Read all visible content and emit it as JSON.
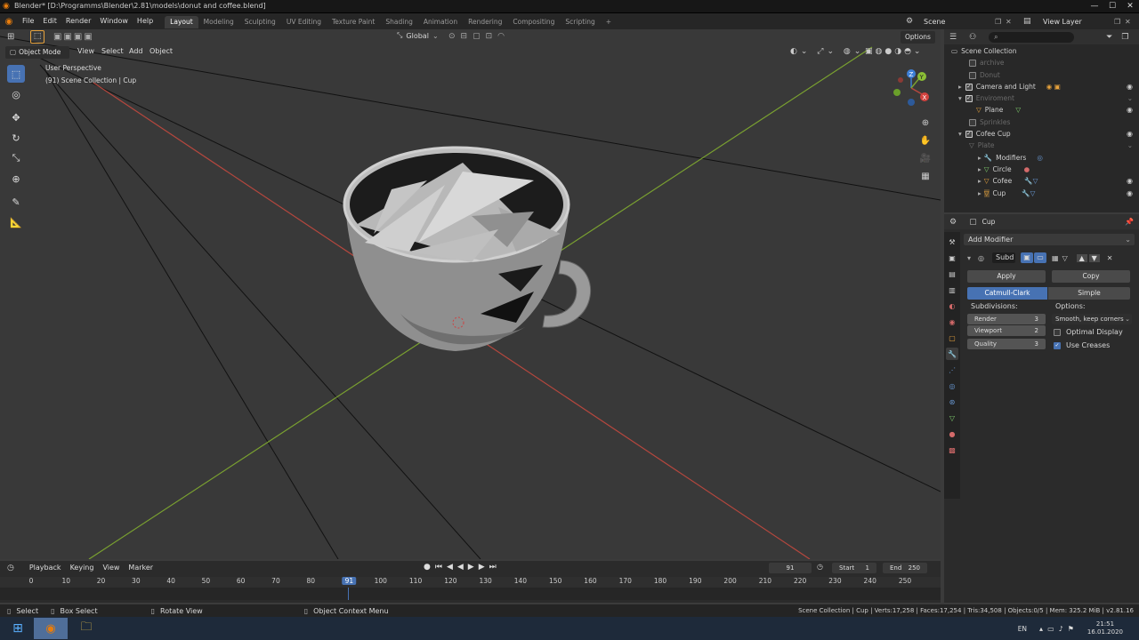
{
  "titlebar": {
    "title": "Blender* [D:\\Programms\\Blender\\2.81\\models\\donut and coffee.blend]",
    "minimize": "—",
    "maximize": "☐",
    "close": "✕"
  },
  "topbar": {
    "menus": [
      "File",
      "Edit",
      "Render",
      "Window",
      "Help"
    ],
    "workspaces": [
      "Layout",
      "Modeling",
      "Sculpting",
      "UV Editing",
      "Texture Paint",
      "Shading",
      "Animation",
      "Rendering",
      "Compositing",
      "Scripting"
    ],
    "add_tab": "+",
    "scene": "Scene",
    "view_layer": "View Layer"
  },
  "viewport": {
    "transform_orientation": "Global",
    "options": "Options",
    "mode": "Object Mode",
    "menus": [
      "View",
      "Select",
      "Add",
      "Object"
    ],
    "overlay_title": "User Perspective",
    "overlay_sub": "(91) Scene Collection | Cup",
    "gizmo": {
      "x": "X",
      "y": "Y",
      "z": "Z"
    },
    "colors": {
      "x_axis": "#b5473e",
      "y_axis": "#7aa130",
      "z_axis": "#3d7fd6"
    }
  },
  "outliner": {
    "search_placeholder": "",
    "root": "Scene Collection",
    "rows": [
      {
        "label": "archive",
        "dim": true,
        "checked": false
      },
      {
        "label": "Donut",
        "dim": true,
        "checked": false
      },
      {
        "label": "Camera and Light",
        "dim": false,
        "checked": true
      },
      {
        "label": "Enviroment",
        "dim": true,
        "checked": true
      },
      {
        "label": "Plane",
        "dim": false,
        "checked": false
      },
      {
        "label": "Sprinkles",
        "dim": true,
        "checked": false
      },
      {
        "label": "Cofee Cup",
        "dim": false,
        "checked": true
      },
      {
        "label": "Plate",
        "dim": true,
        "checked": false
      },
      {
        "label": "Modifiers",
        "dim": false,
        "checked": false
      },
      {
        "label": "Circle",
        "dim": false,
        "checked": false
      },
      {
        "label": "Cofee",
        "dim": false,
        "checked": false
      },
      {
        "label": "Cup",
        "dim": false,
        "checked": false
      }
    ]
  },
  "properties": {
    "object_name": "Cup",
    "add_modifier": "Add Modifier",
    "modifier_name": "Subd",
    "apply": "Apply",
    "copy": "Copy",
    "catmull": "Catmull-Clark",
    "simple": "Simple",
    "subdivisions_label": "Subdivisions:",
    "options_label": "Options:",
    "render_label": "Render",
    "render_value": "3",
    "viewport_label": "Viewport",
    "viewport_value": "2",
    "quality_label": "Quality",
    "quality_value": "3",
    "uv_smooth": "Smooth, keep corners",
    "optimal_display": "Optimal Display",
    "use_creases": "Use Creases"
  },
  "timeline": {
    "menus": [
      "Playback",
      "Keying",
      "View",
      "Marker"
    ],
    "current_frame": "91",
    "start_label": "Start",
    "start": "1",
    "end_label": "End",
    "end": "250",
    "ticks": [
      "0",
      "10",
      "20",
      "30",
      "40",
      "50",
      "60",
      "70",
      "80",
      "91",
      "100",
      "110",
      "120",
      "130",
      "140",
      "150",
      "160",
      "170",
      "180",
      "190",
      "200",
      "210",
      "220",
      "230",
      "240",
      "250"
    ]
  },
  "statusbar": {
    "select": "Select",
    "box_select": "Box Select",
    "rotate_view": "Rotate View",
    "context_menu": "Object Context Menu",
    "stats": "Scene Collection | Cup | Verts:17,258 | Faces:17,254 | Tris:34,508 | Objects:0/5 | Mem: 325.2 MiB | v2.81.16"
  },
  "taskbar": {
    "lang": "EN",
    "time": "21:51",
    "date": "16.01.2020"
  }
}
